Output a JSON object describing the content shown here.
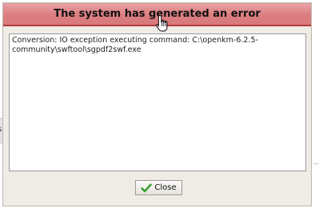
{
  "background": {
    "left_panel_fragment": "s"
  },
  "dialog": {
    "title": "The system has generated an error",
    "message": "Conversion: IO exception executing command: C:\\openkm-6.2.5-community\\swftool\\sgpdf2swf.exe",
    "close_label": "Close",
    "icons": {
      "close": "check-icon",
      "pointer": "hand-cursor-icon"
    },
    "colors": {
      "title_bar": "#dc7d80",
      "title_border": "#b33a40",
      "dialog_bg": "#efece6",
      "check_icon": "#3aa02f"
    }
  }
}
